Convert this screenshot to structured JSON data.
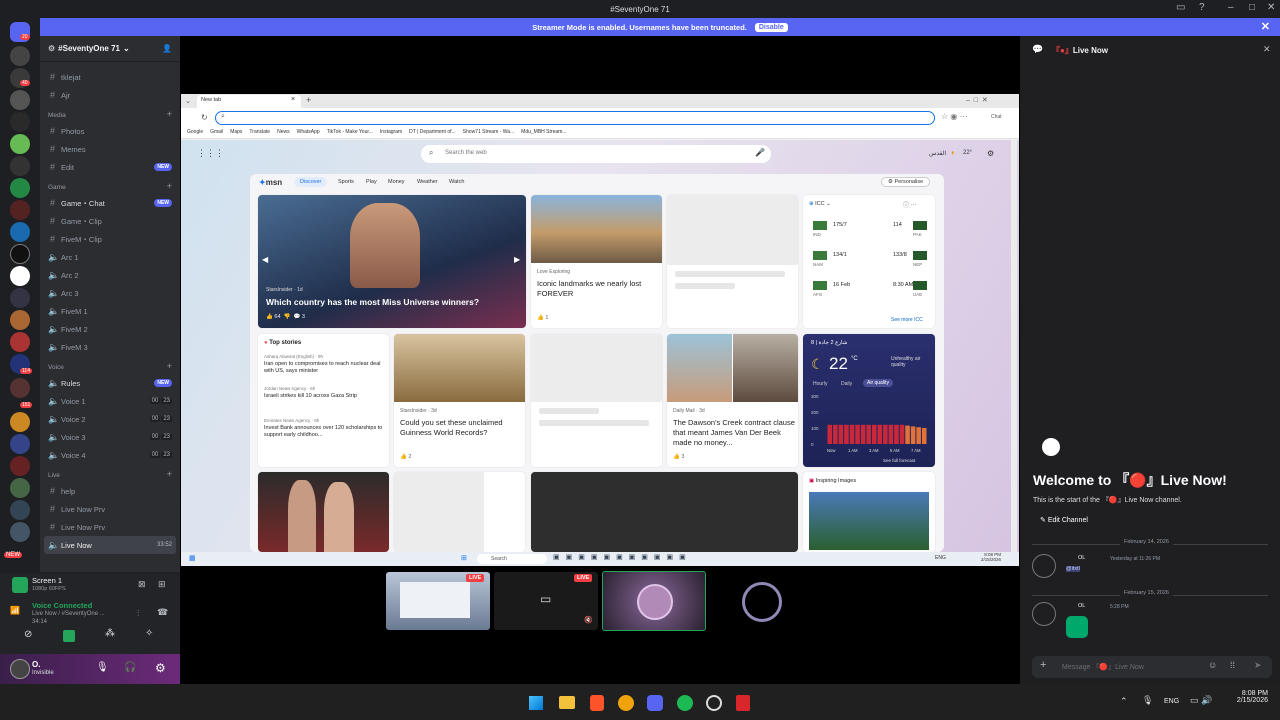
{
  "window": {
    "title": "#SeventyOne 71"
  },
  "banner": {
    "text": "Streamer Mode is enabled. Usernames have been truncated.",
    "disable_label": "Disable"
  },
  "server": {
    "name": "#SeventyOne 71"
  },
  "rail_badges": [
    "20",
    "40",
    "114",
    "151",
    "NEW"
  ],
  "channels": {
    "top": [
      {
        "label": "tklejat"
      },
      {
        "label": "Ajr"
      }
    ],
    "media": {
      "category": "Media",
      "items": [
        {
          "label": "Photos"
        },
        {
          "label": "Memes"
        },
        {
          "label": "Edit",
          "badge": "NEW"
        }
      ]
    },
    "game": {
      "category": "Game",
      "items": [
        {
          "label": "Game・Chat",
          "badge": "NEW"
        },
        {
          "label": "Game・Clip"
        },
        {
          "label": "FiveM・Clip"
        },
        {
          "label": "Arc 1"
        },
        {
          "label": "Arc 2"
        },
        {
          "label": "Arc 3"
        },
        {
          "label": "FiveM 1"
        },
        {
          "label": "FiveM 2"
        },
        {
          "label": "FiveM 3"
        }
      ]
    },
    "voice": {
      "category": "Voice",
      "items": [
        {
          "label": "Rules",
          "badge": "NEW"
        },
        {
          "label": "Voice 1",
          "c1": "00",
          "c2": "23"
        },
        {
          "label": "Voice 2",
          "c1": "00",
          "c2": "23"
        },
        {
          "label": "Voice 3",
          "c1": "00",
          "c2": "23"
        },
        {
          "label": "Voice 4",
          "c1": "00",
          "c2": "23"
        }
      ]
    },
    "live": {
      "category": "Live",
      "items": [
        {
          "label": "help"
        },
        {
          "label": "Live Now Prv"
        },
        {
          "label": "Live Now Prv"
        },
        {
          "label": "Live Now",
          "time": "33:52"
        }
      ]
    }
  },
  "share": {
    "title": "Screen 1",
    "sub": "1080p 60FPS"
  },
  "voice": {
    "status": "Voice Connected",
    "channel": "Live Now / #SeventyOne ...",
    "time": "34:14"
  },
  "user": {
    "name": "O.",
    "status": "Invisible"
  },
  "right": {
    "header": "Live Now",
    "welcome_title": "Welcome to 『🔴』Live Now!",
    "welcome_sub": "This is the start of the 『🔴』Live Now channel.",
    "edit_channel": "Edit Channel",
    "date1": "February 14, 2026",
    "msg1_name": "OL",
    "msg1_time": "Yesterday at 11:26 PM",
    "msg1_text": "@itxtl",
    "date2": "February 15, 2026",
    "msg2_name": "OL",
    "msg2_time": "5:28 PM",
    "input_placeholder": "Message 『🔴』Live Now"
  },
  "browser": {
    "tab": "New tab",
    "bookmarks": [
      "Google",
      "Gmail",
      "Maps",
      "Translate",
      "News",
      "WhatsApp",
      "TikTok - Make Your...",
      "Instagram",
      "DT | Department of...",
      "Show71 Stream - Wa...",
      "Mdu_MBH Stream..."
    ],
    "search_placeholder": "Search the web",
    "weather_top": "القدس",
    "temp_top": "22°",
    "msn": {
      "logo": "msn",
      "nav": [
        "Discover",
        "Sports",
        "Play",
        "Money",
        "Weather",
        "Watch"
      ],
      "personalise": "Personalise",
      "hero_source": "StarsInsider · 1d",
      "hero_title": "Which country has the most Miss Universe winners?",
      "hero_likes": "64",
      "hero_comments": "3",
      "colosseum_source": "Love Exploring",
      "colosseum_title": "Iconic landmarks we nearly lost FOREVER",
      "colosseum_likes": "1",
      "icc_title": "ICC",
      "icc_rows": [
        {
          "a": "IND",
          "as": "175/7",
          "b": "PAK",
          "bs": "114"
        },
        {
          "a": "NAM",
          "as": "134/1",
          "b": "NEP",
          "bs": "133/8"
        },
        {
          "a": "AFG",
          "as": "16 Feb",
          "b": "UAE",
          "bs": "8:30 AM"
        }
      ],
      "icc_more": "See more ICC",
      "top_stories_title": "Top stories",
      "stories": [
        {
          "src": "Asharq Alawsat (English) · 9h",
          "txt": "Iran open to compromises to reach nuclear deal with US, says minister"
        },
        {
          "src": "Jordan News Agency · 6h",
          "txt": "Israeli strikes kill 10 across Gaza Strip"
        },
        {
          "src": "Emirates News Agency · 6h",
          "txt": "Invest Bank announces over 120 scholarships to support early childhoo..."
        }
      ],
      "guinness_source": "StarsInsider · 3d",
      "guinness_title": "Could you set these unclaimed Guinness World Records?",
      "guinness_likes": "2",
      "dawson_source": "Daily Mail · 3d",
      "dawson_title": "The Dawson's Creek contract clause that meant James Van Der Beek made no money...",
      "dawson_likes": "3",
      "weather_loc": "8 | شارع 2 جادة",
      "weather_temp": "22",
      "weather_unit": "°C",
      "weather_aq": "Unhealthy air quality",
      "weather_tabs": [
        "Hourly",
        "Daily",
        "Air quality"
      ],
      "weather_axis": [
        "300",
        "200",
        "100",
        "0"
      ],
      "weather_times": [
        "Now",
        "1 AM",
        "3 AM",
        "5 AM",
        "7 AM"
      ],
      "weather_forecast": "See full forecast",
      "aq_values": [
        120,
        120,
        120,
        120,
        120,
        120,
        120,
        120,
        120,
        120,
        120,
        120,
        120,
        120,
        115,
        110,
        105,
        100
      ],
      "inspiring": "Inspiring Images"
    },
    "taskbar_search": "Search",
    "taskbar_lang": "ENG",
    "taskbar_time": "8:08 PM",
    "taskbar_date": "2/15/2026"
  },
  "streams": {
    "live_label": "LIVE"
  },
  "taskbar": {
    "lang": "ENG",
    "time": "8:08 PM",
    "date": "2/15/2026"
  }
}
